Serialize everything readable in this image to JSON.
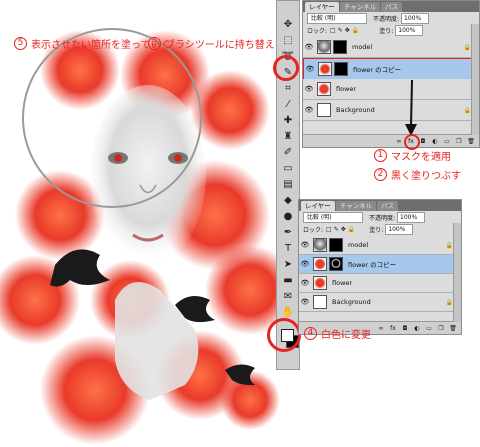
{
  "annotations": {
    "step5": {
      "num": "5",
      "text": "表示させたい箇所を塗っていく"
    },
    "step3": {
      "num": "3",
      "text": "ブラシツールに持ち替える"
    },
    "step1": {
      "num": "1",
      "text": "マスクを適用"
    },
    "step2": {
      "num": "2",
      "text": "黒く塗りつぶす"
    },
    "step4": {
      "num": "4",
      "text": "白色に変更"
    }
  },
  "colors": {
    "annotation": "#e8231f",
    "selection": "#a6c8ec",
    "panel": "#dcdcdc"
  },
  "panel_top": {
    "tabs": [
      "レイヤー",
      "チャンネル",
      "パス"
    ],
    "blend_mode": "比較 (明)",
    "opacity_label": "不透明度:",
    "opacity_value": "100%",
    "lock_label": "ロック:",
    "fill_label": "塗り:",
    "fill_value": "100%",
    "layers": [
      {
        "name": "model",
        "visible": true,
        "locked": true
      },
      {
        "name": "flower のコピー",
        "visible": true,
        "selected": true
      },
      {
        "name": "flower",
        "visible": true
      },
      {
        "name": "Background",
        "visible": true,
        "locked": true
      }
    ]
  },
  "panel_bottom": {
    "tabs": [
      "レイヤー",
      "チャンネル",
      "パス"
    ],
    "blend_mode": "比較 (明)",
    "opacity_label": "不透明度:",
    "opacity_value": "100%",
    "lock_label": "ロック:",
    "fill_label": "塗り:",
    "fill_value": "100%",
    "layers": [
      {
        "name": "model",
        "visible": true,
        "locked": true
      },
      {
        "name": "flower のコピー",
        "visible": true,
        "selected": true
      },
      {
        "name": "flower",
        "visible": true
      },
      {
        "name": "Background",
        "visible": true,
        "locked": true
      }
    ]
  },
  "tools": [
    "move-tool",
    "marquee-tool",
    "lasso-tool",
    "magic-wand-tool",
    "crop-tool",
    "eyedropper-tool",
    "healing-tool",
    "brush-tool",
    "clone-stamp-tool",
    "history-brush-tool",
    "eraser-tool",
    "gradient-tool",
    "blur-tool",
    "dodge-tool",
    "pen-tool",
    "type-tool",
    "path-selection-tool",
    "shape-tool",
    "notes-tool",
    "hand-tool",
    "zoom-tool"
  ]
}
